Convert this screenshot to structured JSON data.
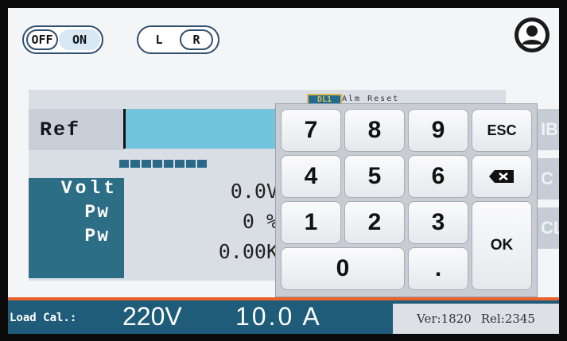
{
  "toggles": {
    "power": {
      "off_label": "OFF",
      "on_label": "ON",
      "state": "ON"
    },
    "side": {
      "left_label": "L",
      "right_label": "R",
      "state": "R"
    }
  },
  "icons": {
    "user": "user-avatar-icon",
    "backspace": "backspace-icon"
  },
  "reference": {
    "label": "Ref",
    "value": ""
  },
  "measurements": [
    {
      "label": "Volt",
      "value": "0.0V"
    },
    {
      "label": "Pw",
      "value": "0 %"
    },
    {
      "label": "Pw",
      "value": "0.00K"
    }
  ],
  "keypad": {
    "keys": [
      "7",
      "8",
      "9",
      "ESC",
      "4",
      "5",
      "6",
      "1",
      "2",
      "3",
      "OK",
      "0",
      "."
    ]
  },
  "status_bar": {
    "label": "Load Cal.:",
    "voltage": "220V",
    "current": "10.0 A",
    "version": "Ver:1820",
    "release": "Rel:2345"
  },
  "colors": {
    "accent": "#1f5c7a",
    "input_fill": "#72c4dc",
    "status_border": "#e9642c"
  }
}
